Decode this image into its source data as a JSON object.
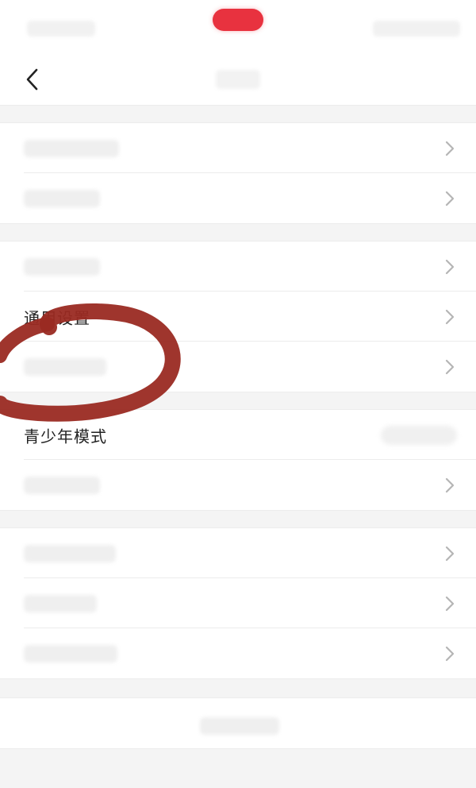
{
  "status_bar": {
    "record_indicator_color": "#e8323f"
  },
  "nav": {
    "back_icon": "chevron-left-icon"
  },
  "settings": {
    "groups": [
      {
        "items": [
          {
            "label": "",
            "obscured": true,
            "has_chevron": true
          },
          {
            "label": "",
            "obscured": true,
            "has_chevron": true
          }
        ]
      },
      {
        "items": [
          {
            "label": "",
            "obscured": true,
            "has_chevron": true
          },
          {
            "label": "通用设置",
            "obscured": false,
            "has_chevron": true
          },
          {
            "label": "",
            "obscured": true,
            "has_chevron": true
          }
        ]
      },
      {
        "items": [
          {
            "label": "青少年模式",
            "obscured": false,
            "has_chevron": false
          },
          {
            "label": "",
            "obscured": true,
            "has_chevron": true
          }
        ]
      },
      {
        "items": [
          {
            "label": "",
            "obscured": true,
            "has_chevron": true
          },
          {
            "label": "",
            "obscured": true,
            "has_chevron": true
          },
          {
            "label": "",
            "obscured": true,
            "has_chevron": true
          }
        ]
      }
    ]
  },
  "annotation": {
    "shape": "hand-drawn circle",
    "color": "#9a2a22",
    "target": "通用设置"
  },
  "colors": {
    "background": "#ffffff",
    "separator": "#f4f4f4",
    "text": "#222222",
    "chevron": "#b5b5b5"
  }
}
